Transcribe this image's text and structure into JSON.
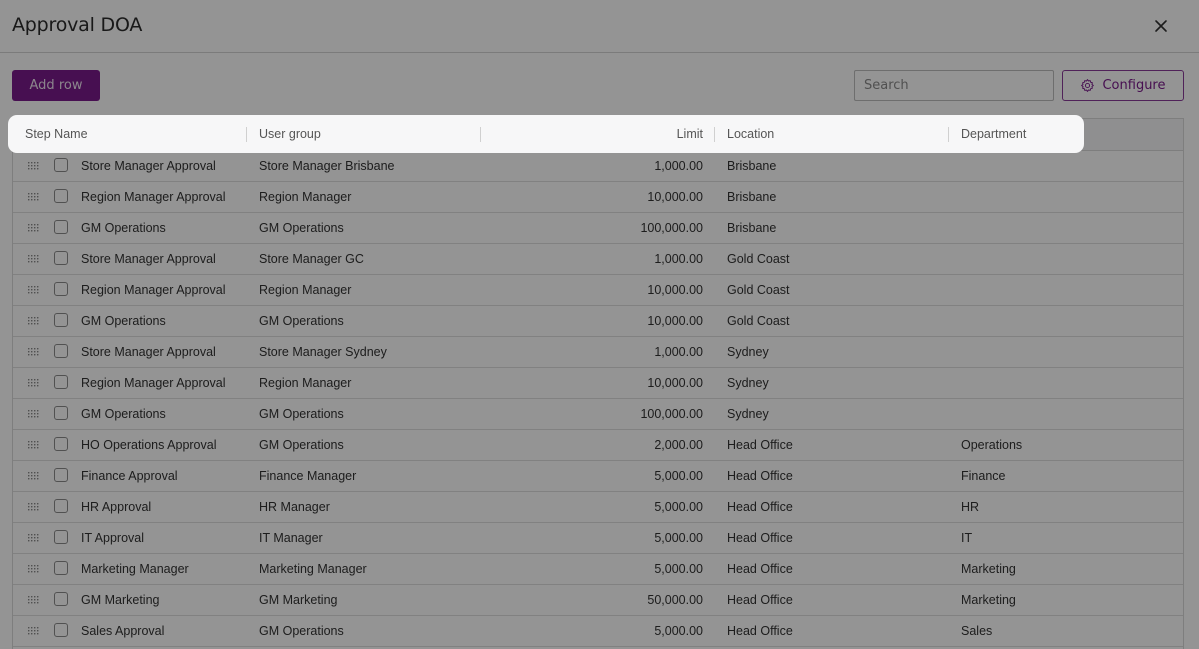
{
  "dialog": {
    "title": "Approval DOA",
    "close_icon": "close-icon"
  },
  "toolbar": {
    "add_row_label": "Add row",
    "search_placeholder": "Search",
    "search_value": "",
    "configure_label": "Configure",
    "configure_icon": "gear-icon"
  },
  "columns": {
    "step_name": "Step Name",
    "user_group": "User group",
    "limit": "Limit",
    "location": "Location",
    "department": "Department"
  },
  "rows": [
    {
      "step": "Store Manager Approval",
      "group": "Store Manager Brisbane",
      "limit": "1,000.00",
      "location": "Brisbane",
      "department": ""
    },
    {
      "step": "Region Manager Approval",
      "group": "Region Manager",
      "limit": "10,000.00",
      "location": "Brisbane",
      "department": ""
    },
    {
      "step": "GM Operations",
      "group": "GM Operations",
      "limit": "100,000.00",
      "location": "Brisbane",
      "department": ""
    },
    {
      "step": "Store Manager Approval",
      "group": "Store Manager GC",
      "limit": "1,000.00",
      "location": "Gold Coast",
      "department": ""
    },
    {
      "step": "Region Manager Approval",
      "group": "Region Manager",
      "limit": "10,000.00",
      "location": "Gold Coast",
      "department": ""
    },
    {
      "step": "GM Operations",
      "group": "GM Operations",
      "limit": "10,000.00",
      "location": "Gold Coast",
      "department": ""
    },
    {
      "step": "Store Manager Approval",
      "group": "Store Manager Sydney",
      "limit": "1,000.00",
      "location": "Sydney",
      "department": ""
    },
    {
      "step": "Region Manager Approval",
      "group": "Region Manager",
      "limit": "10,000.00",
      "location": "Sydney",
      "department": ""
    },
    {
      "step": "GM Operations",
      "group": "GM Operations",
      "limit": "100,000.00",
      "location": "Sydney",
      "department": ""
    },
    {
      "step": "HO Operations Approval",
      "group": "GM Operations",
      "limit": "2,000.00",
      "location": "Head Office",
      "department": "Operations"
    },
    {
      "step": "Finance Approval",
      "group": "Finance Manager",
      "limit": "5,000.00",
      "location": "Head Office",
      "department": "Finance"
    },
    {
      "step": "HR Approval",
      "group": "HR Manager",
      "limit": "5,000.00",
      "location": "Head Office",
      "department": "HR"
    },
    {
      "step": "IT Approval",
      "group": "IT Manager",
      "limit": "5,000.00",
      "location": "Head Office",
      "department": "IT"
    },
    {
      "step": "Marketing Manager",
      "group": "Marketing Manager",
      "limit": "5,000.00",
      "location": "Head Office",
      "department": "Marketing"
    },
    {
      "step": "GM Marketing",
      "group": "GM Marketing",
      "limit": "50,000.00",
      "location": "Head Office",
      "department": "Marketing"
    },
    {
      "step": "Sales Approval",
      "group": "GM Operations",
      "limit": "5,000.00",
      "location": "Head Office",
      "department": "Sales"
    }
  ],
  "colors": {
    "primary": "#7a1a8c",
    "overlay": "rgba(0,0,0,0.42)",
    "header_bg": "#f7f7f8"
  }
}
